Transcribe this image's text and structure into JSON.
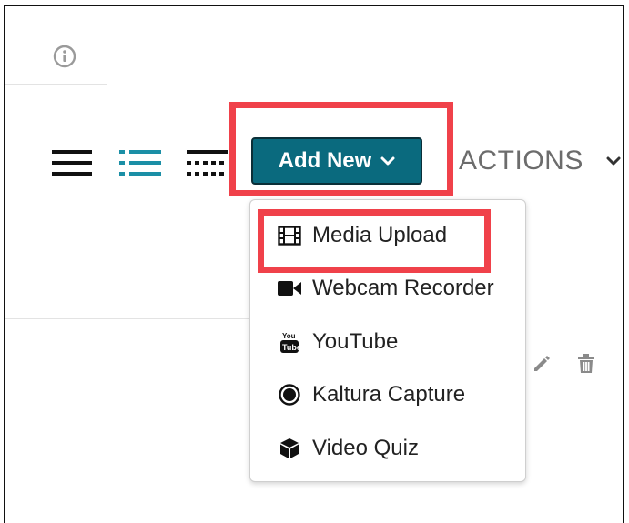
{
  "toolbar": {
    "add_new_label": "Add New",
    "actions_label": "ACTIONS"
  },
  "add_new_menu": {
    "items": [
      {
        "label": "Media Upload",
        "icon": "film-icon"
      },
      {
        "label": "Webcam Recorder",
        "icon": "video-camera-icon"
      },
      {
        "label": "YouTube",
        "icon": "youtube-icon"
      },
      {
        "label": "Kaltura Capture",
        "icon": "record-circle-icon"
      },
      {
        "label": "Video Quiz",
        "icon": "cube-icon"
      }
    ]
  },
  "colors": {
    "brand_teal": "#0a6a7e",
    "highlight_red": "#f0414a",
    "active_view_icon": "#1b8fa6"
  }
}
